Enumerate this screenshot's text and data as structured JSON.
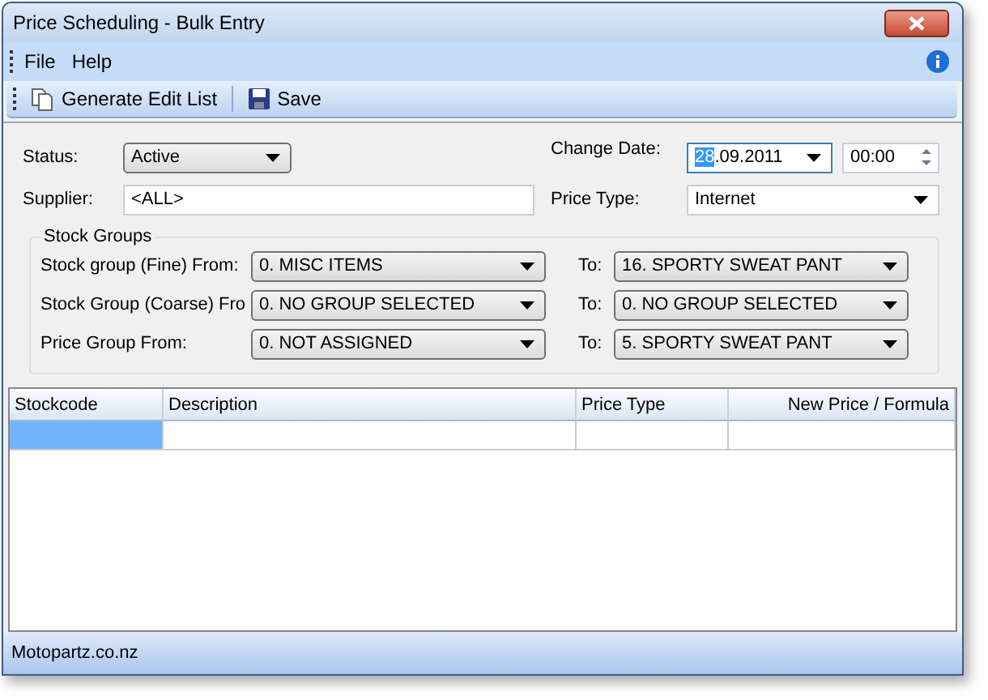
{
  "window": {
    "title": "Price Scheduling - Bulk Entry"
  },
  "menu": [
    "File",
    "Help"
  ],
  "toolbar": [
    {
      "kind": "copy",
      "label": "Generate Edit List"
    },
    {
      "kind": "save",
      "label": "Save"
    }
  ],
  "form": {
    "status": {
      "label": "Status:",
      "value": "Active"
    },
    "supplier": {
      "label": "Supplier:",
      "value": "<ALL>"
    },
    "change_date": {
      "label": "Change Date:",
      "selected_part": "28",
      "rest": ".09.2011",
      "time": "00:00"
    },
    "price_type": {
      "label": "Price Type:",
      "value": "Internet"
    }
  },
  "stock_groups": {
    "title": "Stock Groups",
    "rows": [
      {
        "label": "Stock group (Fine) From:",
        "from": "0. MISC ITEMS",
        "to_label": "To:",
        "to": "16. SPORTY SWEAT PANT"
      },
      {
        "label": "Stock Group (Coarse) Fro",
        "from": "0. NO GROUP SELECTED",
        "to_label": "To:",
        "to": "0. NO GROUP SELECTED"
      },
      {
        "label": "Price Group From:",
        "from": "0. NOT ASSIGNED",
        "to_label": "To:",
        "to": "5. SPORTY SWEAT PANT"
      }
    ]
  },
  "table": {
    "columns": [
      "Stockcode",
      "Description",
      "Price Type",
      "New Price / Formula"
    ],
    "rows": [
      {
        "cells": [
          {
            "selected": true
          },
          {
            "selected": false
          },
          {
            "selected": false
          },
          {
            "selected": false
          }
        ]
      }
    ]
  },
  "status_bar": "Motopartz.co.nz"
}
